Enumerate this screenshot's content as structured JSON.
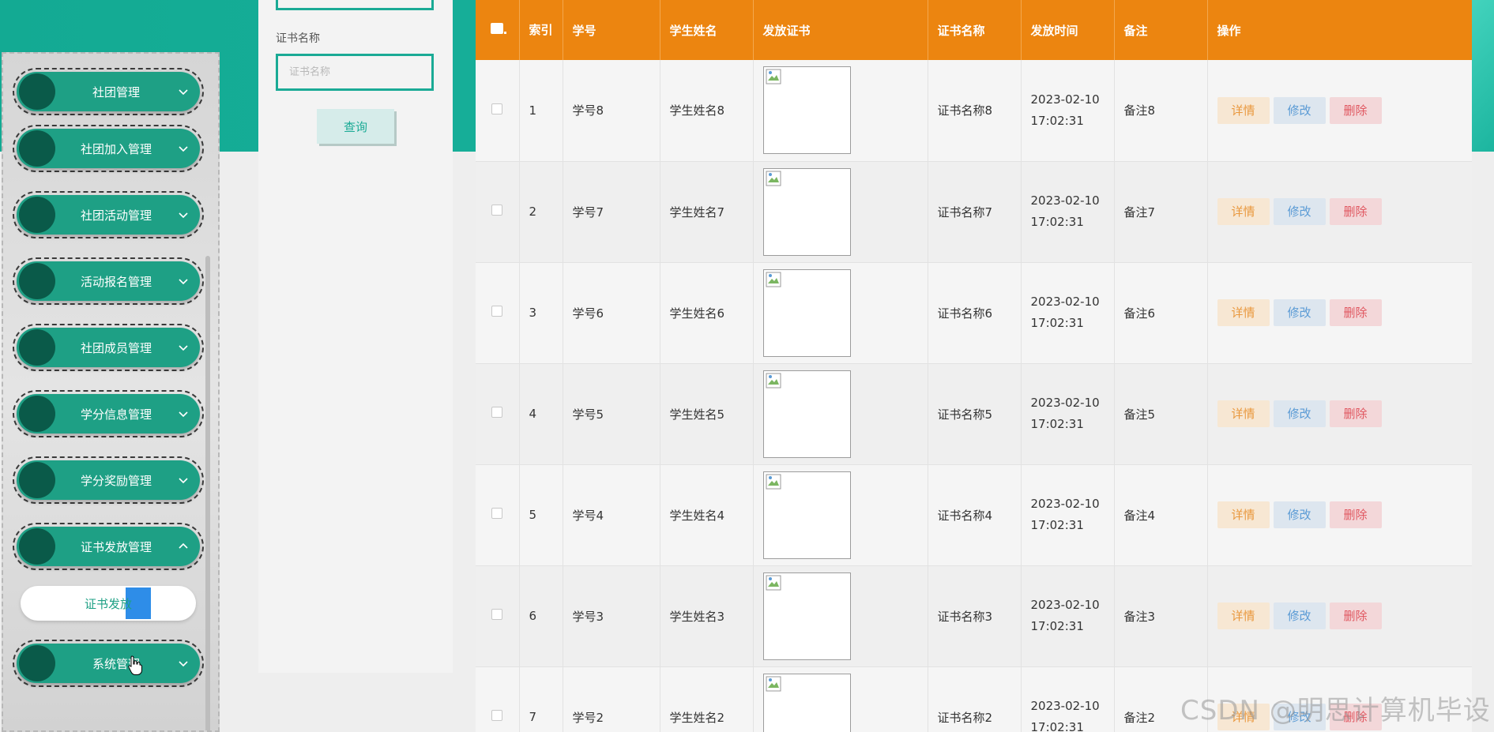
{
  "sidebar": {
    "menu_items": [
      {
        "label": "社团管理",
        "expanded": false
      },
      {
        "label": "社团加入管理",
        "expanded": false
      },
      {
        "label": "社团活动管理",
        "expanded": false
      },
      {
        "label": "活动报名管理",
        "expanded": false
      },
      {
        "label": "社团成员管理",
        "expanded": false
      },
      {
        "label": "学分信息管理",
        "expanded": false
      },
      {
        "label": "学分奖励管理",
        "expanded": false
      },
      {
        "label": "证书发放管理",
        "expanded": true
      },
      {
        "label": "系统管理",
        "expanded": false
      }
    ],
    "sub_item": {
      "label": "证书发放"
    }
  },
  "search": {
    "cert_name_label": "证书名称",
    "cert_name_placeholder": "证书名称",
    "query_button": "查询"
  },
  "table": {
    "headers": {
      "index": "索引",
      "student_no": "学号",
      "student_name": "学生姓名",
      "certificate_image": "发放证书",
      "certificate_name": "证书名称",
      "issue_time": "发放时间",
      "remark": "备注",
      "actions": "操作"
    },
    "actions": {
      "detail": "详情",
      "edit": "修改",
      "delete": "删除"
    },
    "rows": [
      {
        "index": "1",
        "student_no": "学号8",
        "student_name": "学生姓名8",
        "certificate_name": "证书名称8",
        "date": "2023-02-10",
        "time": "17:02:31",
        "remark": "备注8"
      },
      {
        "index": "2",
        "student_no": "学号7",
        "student_name": "学生姓名7",
        "certificate_name": "证书名称7",
        "date": "2023-02-10",
        "time": "17:02:31",
        "remark": "备注7"
      },
      {
        "index": "3",
        "student_no": "学号6",
        "student_name": "学生姓名6",
        "certificate_name": "证书名称6",
        "date": "2023-02-10",
        "time": "17:02:31",
        "remark": "备注6"
      },
      {
        "index": "4",
        "student_no": "学号5",
        "student_name": "学生姓名5",
        "certificate_name": "证书名称5",
        "date": "2023-02-10",
        "time": "17:02:31",
        "remark": "备注5"
      },
      {
        "index": "5",
        "student_no": "学号4",
        "student_name": "学生姓名4",
        "certificate_name": "证书名称4",
        "date": "2023-02-10",
        "time": "17:02:31",
        "remark": "备注4"
      },
      {
        "index": "6",
        "student_no": "学号3",
        "student_name": "学生姓名3",
        "certificate_name": "证书名称3",
        "date": "2023-02-10",
        "time": "17:02:31",
        "remark": "备注3"
      },
      {
        "index": "7",
        "student_no": "学号2",
        "student_name": "学生姓名2",
        "certificate_name": "证书名称2",
        "date": "2023-02-10",
        "time": "17:02:31",
        "remark": "备注2"
      }
    ]
  },
  "watermark": "CSDN @明思计算机毕设",
  "colors": {
    "teal": "#1aaa95",
    "menu_green": "#1ea085",
    "menu_circle": "#0a5a49",
    "table_header": "#ec8510",
    "detail": "#e9983e",
    "edit": "#5b9bd5",
    "delete": "#e0565f",
    "selection": "#2e8de8"
  },
  "icons": {
    "menu_chevron_collapsed": "chevron-down-icon",
    "menu_chevron_expanded": "chevron-up-icon",
    "certificate_image": "broken-image-icon",
    "cursor": "hand-pointer-icon"
  }
}
